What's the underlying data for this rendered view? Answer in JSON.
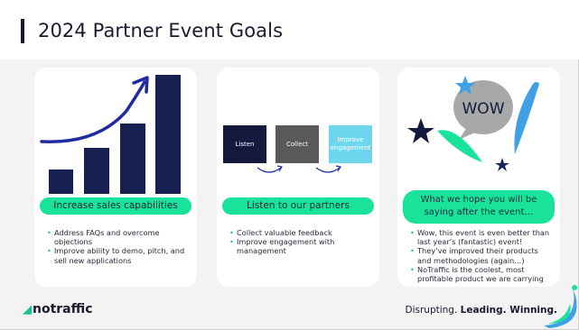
{
  "slide": {
    "title": "2024 Partner Event Goals"
  },
  "cards": [
    {
      "pill": "Increase sales capabilities",
      "bullets": [
        "Address FAQs and overcome objections",
        "Improve ability to demo, pitch, and sell new applications"
      ]
    },
    {
      "pill": "Listen to our partners",
      "flow": [
        "Listen",
        "Collect",
        "Improve engagement"
      ],
      "bullets": [
        "Collect valuable feedback",
        "Improve engagement with management"
      ]
    },
    {
      "pill_line1": "What we hope you will be",
      "pill_line2": "saying after the event…",
      "bubble_text": "WOW",
      "bullets": [
        "Wow, this event is even better than last year’s (fantastic) event!",
        "They’ve improved their products and methodologies (again…)",
        "NoTraffic is the coolest, most profitable product we are carrying"
      ]
    }
  ],
  "footer": {
    "logo": "notraffic",
    "tag_prefix": "Disrupting. ",
    "tag_bold": "Leading. Winning."
  },
  "colors": {
    "accent": "#19e39b",
    "navy": "#141a3d",
    "sky": "#6fd6f0"
  }
}
